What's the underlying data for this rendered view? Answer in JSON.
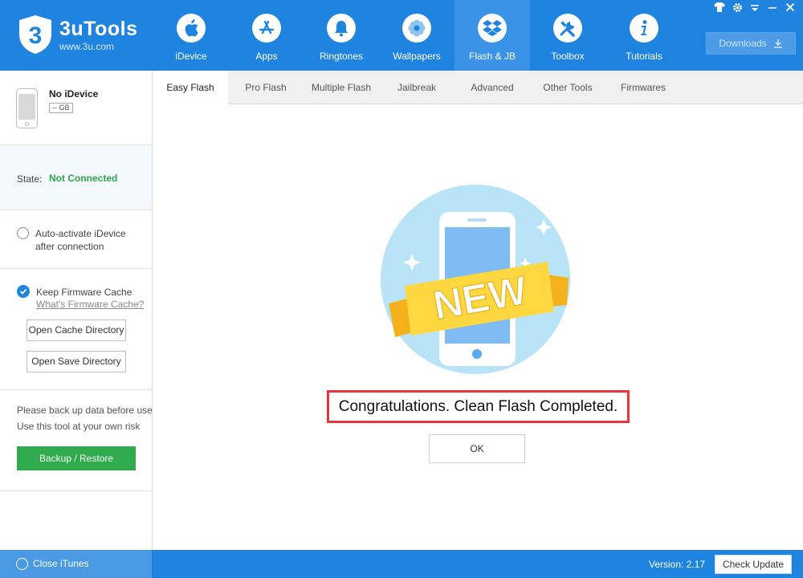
{
  "app": {
    "title": "3uTools",
    "site": "www.3u.com",
    "logo_digit": "3",
    "accent": "#1f83e0"
  },
  "nav": [
    {
      "label": "iDevice",
      "icon": "apple-icon"
    },
    {
      "label": "Apps",
      "icon": "app-store-icon"
    },
    {
      "label": "Ringtones",
      "icon": "bell-icon"
    },
    {
      "label": "Wallpapers",
      "icon": "flower-icon"
    },
    {
      "label": "Flash & JB",
      "icon": "dropbox-box-icon",
      "active": true
    },
    {
      "label": "Toolbox",
      "icon": "tools-icon"
    },
    {
      "label": "Tutorials",
      "icon": "info-icon"
    }
  ],
  "window_controls": [
    "skin-icon",
    "gear-icon",
    "menu-icon",
    "minimize-icon",
    "close-icon"
  ],
  "downloads": {
    "label": "Downloads",
    "icon": "download-icon"
  },
  "sidebar": {
    "device_name": "No iDevice",
    "capacity": "-- GB",
    "state_label": "State:",
    "state_value": "Not Connected",
    "state_color": "#2ea44a",
    "auto_activate_label": "Auto-activate iDevice after connection",
    "keep_cache_label": "Keep Firmware Cache",
    "whats_cache_link": "What's Firmware Cache?",
    "open_cache_btn": "Open Cache Directory",
    "open_save_btn": "Open Save Directory",
    "warn_line1": "Please back up data before use",
    "warn_line2": "Use this tool at your own risk",
    "backup_btn": "Backup / Restore"
  },
  "tabs": [
    {
      "label": "Easy Flash",
      "active": true
    },
    {
      "label": "Pro Flash"
    },
    {
      "label": "Multiple Flash"
    },
    {
      "label": "Jailbreak"
    },
    {
      "label": "Advanced"
    },
    {
      "label": "Other Tools"
    },
    {
      "label": "Firmwares"
    }
  ],
  "main": {
    "banner_text": "NEW",
    "message": "Congratulations. Clean Flash Completed.",
    "ok_btn": "OK"
  },
  "footer": {
    "close_itunes": "Close iTunes",
    "version": "Version: 2.17",
    "check_update": "Check Update"
  }
}
